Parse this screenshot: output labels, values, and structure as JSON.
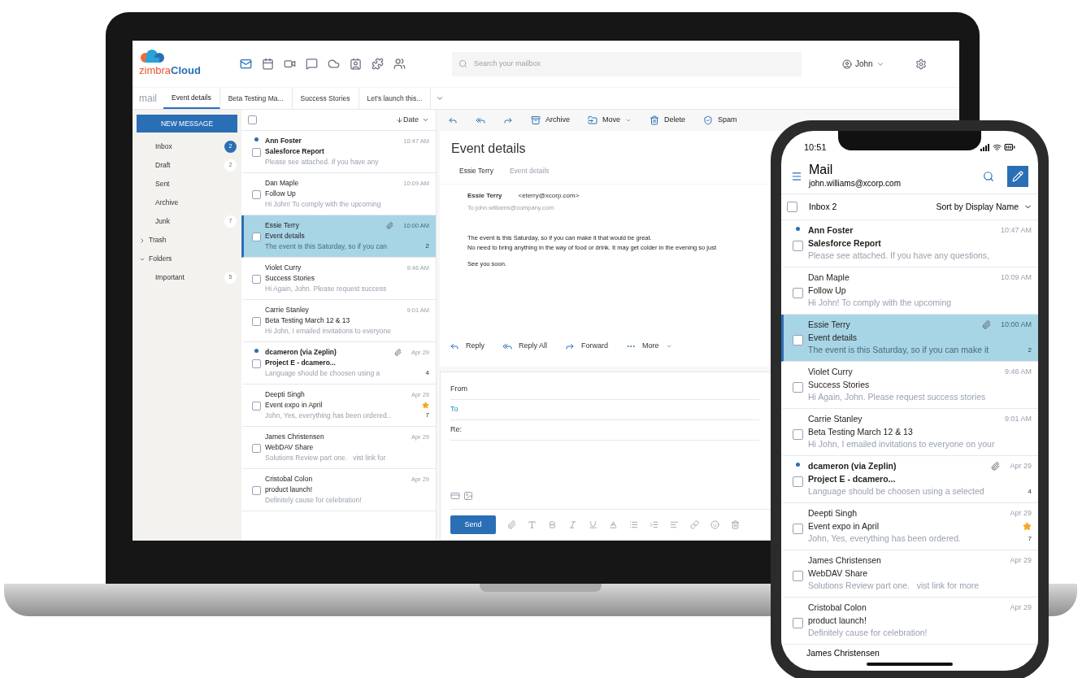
{
  "laptop": {
    "logo": {
      "part_a": "zimbra",
      "part_b": "Cloud"
    },
    "apps": [
      {
        "selected": true
      },
      {
        "selected": false
      },
      {
        "selected": false
      },
      {
        "selected": false
      },
      {
        "selected": false
      },
      {
        "selected": false
      },
      {
        "selected": false
      },
      {
        "selected": false
      }
    ],
    "search": {
      "placeholder": "Search your mailbox"
    },
    "user": {
      "name": "John"
    },
    "app_label": "mail",
    "tabs": [
      {
        "label": "Event details",
        "selected": true
      },
      {
        "label": "Beta Testing Ma...",
        "selected": false
      },
      {
        "label": "Success Stories",
        "selected": false
      },
      {
        "label": "Let's launch this...",
        "selected": false
      }
    ],
    "new_message": "NEW MESSAGE",
    "folders": [
      {
        "kind": "folder",
        "name": "Inbox",
        "count": "2",
        "highlighted": true
      },
      {
        "kind": "folder",
        "name": "Draft",
        "count": "2",
        "highlighted": false
      },
      {
        "kind": "folder",
        "name": "Sent"
      },
      {
        "kind": "folder",
        "name": "Archive"
      },
      {
        "kind": "folder",
        "name": "Junk",
        "count": "7",
        "highlighted": false
      },
      {
        "kind": "tree",
        "name": "Trash",
        "expanded": false
      },
      {
        "kind": "tree",
        "name": "Folders",
        "expanded": true
      },
      {
        "kind": "folder",
        "name": "Important",
        "count": "5",
        "highlighted": false
      }
    ],
    "select_all": {
      "checked": false
    },
    "sort": "Date",
    "messages": [
      {
        "sender": "Ann Foster",
        "subject": "Salesforce Report",
        "preview": "Please see attached. If you have any",
        "time": "10:47 AM",
        "unread": true,
        "selected": false,
        "checked": false,
        "attachment": false,
        "starred": false
      },
      {
        "sender": "Dan Maple",
        "subject": "Follow Up",
        "preview": "Hi John! To comply with the upcoming",
        "time": "10:09 AM",
        "unread": false,
        "selected": false,
        "checked": false,
        "attachment": false,
        "starred": false
      },
      {
        "sender": "Essie Terry",
        "subject": "Event details",
        "preview": "The event is this Saturday, so if you can",
        "time": "10:00 AM",
        "unread": false,
        "selected": true,
        "checked": false,
        "attachment": true,
        "starred": false,
        "count": "2"
      },
      {
        "sender": "Violet Curry",
        "subject": "Success Stories",
        "preview": "Hi Again, John. Please request success",
        "time": "9:46 AM",
        "unread": false,
        "selected": false,
        "checked": false,
        "attachment": false,
        "starred": false
      },
      {
        "sender": "Carrie Stanley",
        "subject": "Beta Testing March 12 & 13",
        "preview": "Hi John, I emailed invitations to everyone",
        "time": "9:01 AM",
        "unread": false,
        "selected": false,
        "checked": false,
        "attachment": false,
        "starred": false
      },
      {
        "sender": "dcameron (via Zeplin)",
        "subject": "Project E - dcamero...",
        "preview": "Language should be choosen using a",
        "time": "Apr 29",
        "unread": true,
        "selected": false,
        "checked": false,
        "attachment": true,
        "starred": false,
        "count": "4"
      },
      {
        "sender": "Deepti Singh",
        "subject": "Event expo in April",
        "preview": "John, Yes, everything has been ordered..",
        "time": "Apr 29",
        "unread": false,
        "selected": false,
        "checked": false,
        "attachment": false,
        "starred": true,
        "count": "7"
      },
      {
        "sender": "James Christensen",
        "subject": "WebDAV Share",
        "preview": "Solutions Review part one.   vist link for",
        "time": "Apr 29",
        "unread": false,
        "selected": false,
        "checked": false,
        "attachment": false,
        "starred": false
      },
      {
        "sender": "Cristobal Colon",
        "subject": "product launch!",
        "preview": "Definitely cause for celebration!",
        "time": "Apr 29",
        "unread": false,
        "selected": false,
        "checked": false,
        "attachment": false,
        "starred": false
      }
    ],
    "toolbar": [
      {
        "kind": "reply"
      },
      {
        "kind": "reply_all"
      },
      {
        "kind": "forward"
      },
      {
        "kind": "archive",
        "label": "Archive"
      },
      {
        "kind": "move",
        "label": "Move"
      },
      {
        "kind": "delete",
        "label": "Delete"
      },
      {
        "kind": "spam",
        "label": "Spam"
      }
    ],
    "reading": {
      "title": "Event details",
      "thread_sender": "Essie Terry",
      "thread_subject": "Event details",
      "from_name": "Essie Terry",
      "from_email": "<eterry@xcorp.com>",
      "to": "To john.williams@company.com",
      "body": [
        "The event is this Saturday, so if you can make it that would be great.",
        "No need to bring anything in the way of food or drink. It may get colder in the evening so just",
        "See you soon."
      ],
      "actions": [
        {
          "kind": "reply",
          "label": "Reply"
        },
        {
          "kind": "reply_all",
          "label": "Reply All"
        },
        {
          "kind": "forward",
          "label": "Forward"
        },
        {
          "kind": "more",
          "label": "More"
        }
      ]
    },
    "compose": {
      "from": "From",
      "to": "To",
      "re": "Re:",
      "send": "Send"
    }
  },
  "phone": {
    "time": "10:51",
    "title": "Mail",
    "account": "john.williams@xcorp.com",
    "select_all": {
      "checked": false
    },
    "folder": "Inbox 2",
    "sort": "Sort by Display Name",
    "messages": [
      {
        "sender": "Ann Foster",
        "subject": "Salesforce Report",
        "preview": "Please see attached. If you have any questions,",
        "time": "10:47 AM",
        "unread": true,
        "selected": false,
        "checked": false,
        "attachment": false,
        "starred": false
      },
      {
        "sender": "Dan Maple",
        "subject": "Follow Up",
        "preview": "Hi John! To comply with the upcoming",
        "time": "10:09 AM",
        "unread": false,
        "selected": false,
        "checked": false,
        "attachment": false,
        "starred": false
      },
      {
        "sender": "Essie Terry",
        "subject": "Event details",
        "preview": "The event is this Saturday, so if you can make it",
        "time": "10:00 AM",
        "unread": false,
        "selected": true,
        "checked": false,
        "attachment": true,
        "starred": false,
        "count": "2"
      },
      {
        "sender": "Violet Curry",
        "subject": "Success Stories",
        "preview": "Hi Again, John. Please request success stories",
        "time": "9:46 AM",
        "unread": false,
        "selected": false,
        "checked": false,
        "attachment": false,
        "starred": false
      },
      {
        "sender": "Carrie Stanley",
        "subject": "Beta Testing March 12 & 13",
        "preview": "Hi John, I emailed invitations to everyone on your",
        "time": "9:01 AM",
        "unread": false,
        "selected": false,
        "checked": false,
        "attachment": false,
        "starred": false
      },
      {
        "sender": "dcameron (via Zeplin)",
        "subject": "Project E - dcamero...",
        "preview": "Language should be choosen using a selected",
        "time": "Apr 29",
        "unread": true,
        "selected": false,
        "checked": false,
        "attachment": true,
        "starred": false,
        "count": "4"
      },
      {
        "sender": "Deepti Singh",
        "subject": "Event expo in April",
        "preview": "John, Yes, everything has been ordered.",
        "time": "Apr 29",
        "unread": false,
        "selected": false,
        "checked": false,
        "attachment": false,
        "starred": true,
        "count": "7"
      },
      {
        "sender": "James Christensen",
        "subject": "WebDAV Share",
        "preview": "Solutions Review part one.   vist link for more",
        "time": "Apr 29",
        "unread": false,
        "selected": false,
        "checked": false,
        "attachment": false,
        "starred": false
      },
      {
        "sender": "Cristobal Colon",
        "subject": "product launch!",
        "preview": "Definitely cause for celebration!",
        "time": "Apr 29",
        "unread": false,
        "selected": false,
        "checked": false,
        "attachment": false,
        "starred": false
      }
    ],
    "partial_sender": "James Christensen"
  }
}
